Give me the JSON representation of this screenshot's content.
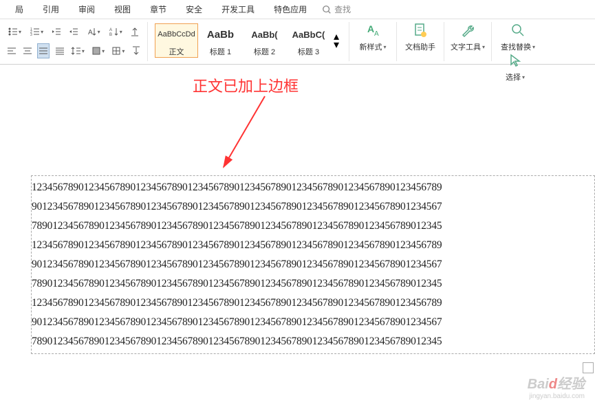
{
  "menu": {
    "items": [
      "局",
      "引用",
      "审阅",
      "视图",
      "章节",
      "安全",
      "开发工具",
      "特色应用"
    ],
    "search_placeholder": "查找"
  },
  "styles": {
    "items": [
      {
        "preview": "AaBbCcDd",
        "label": "正文",
        "selected": true,
        "previewClass": ""
      },
      {
        "preview": "AaBb",
        "label": "标题 1",
        "selected": false,
        "previewClass": "bold"
      },
      {
        "preview": "AaBb(",
        "label": "标题 2",
        "selected": false,
        "previewClass": "med"
      },
      {
        "preview": "AaBbC(",
        "label": "标题 3",
        "selected": false,
        "previewClass": "med"
      }
    ]
  },
  "buttons": {
    "new_style": "新样式",
    "doc_assist": "文档助手",
    "text_tool": "文字工具",
    "find_replace": "查找替换",
    "select": "选择"
  },
  "annotation": "正文已加上边框",
  "document": {
    "lines": [
      "1234567890123456789012345678901234567890123456789012345678901234567890123456789",
      "9012345678901234567890123456789012345678901234567890123456789012345678901234567",
      "7890123456789012345678901234567890123456789012345678901234567890123456789012345",
      "1234567890123456789012345678901234567890123456789012345678901234567890123456789",
      "9012345678901234567890123456789012345678901234567890123456789012345678901234567",
      "7890123456789012345678901234567890123456789012345678901234567890123456789012345",
      "1234567890123456789012345678901234567890123456789012345678901234567890123456789",
      "9012345678901234567890123456789012345678901234567890123456789012345678901234567",
      "7890123456789012345678901234567890123456789012345678901234567890123456789012345"
    ]
  },
  "watermark": {
    "brand_prefix": "Bai",
    "brand_accent": "d",
    "brand_suffix": "经验",
    "url": "jingyan.baidu.com"
  }
}
